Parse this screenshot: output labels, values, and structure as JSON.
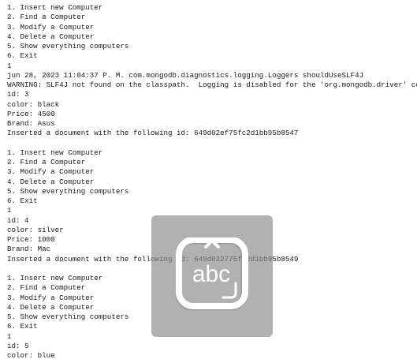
{
  "console": {
    "lines": [
      "1. Insert new Computer",
      "2. Find a Computer",
      "3. Modify a Computer",
      "4. Delete a Computer",
      "5. Show everything computers",
      "6. Exit",
      "1",
      "jun 28, 2023 11:04:37 P. M. com.mongodb.diagnostics.logging.Loggers shouldUseSLF4J",
      "WARNING: SLF4J not found on the classpath.  Logging is disabled for the 'org.mongodb.driver' component",
      "id: 3",
      "color: black",
      "Price: 4500",
      "Brand: Asus",
      "Inserted a document with the following id: 649d02ef75fc2d1bb95b8547",
      "",
      "1. Insert new Computer",
      "2. Find a Computer",
      "3. Modify a Computer",
      "4. Delete a Computer",
      "5. Show everything computers",
      "6. Exit",
      "1",
      "id: 4",
      "color: silver",
      "Price: 1000",
      "Brand: Mac",
      "Inserted a document with the following id: 649d032775fc2d1bb95b8549",
      "",
      "1. Insert new Computer",
      "2. Find a Computer",
      "3. Modify a Computer",
      "4. Delete a Computer",
      "5. Show everything computers",
      "6. Exit",
      "1",
      "id: 5",
      "color: blue"
    ]
  },
  "overlay": {
    "icon": "keyboard-abc-icon",
    "text": "abc"
  }
}
